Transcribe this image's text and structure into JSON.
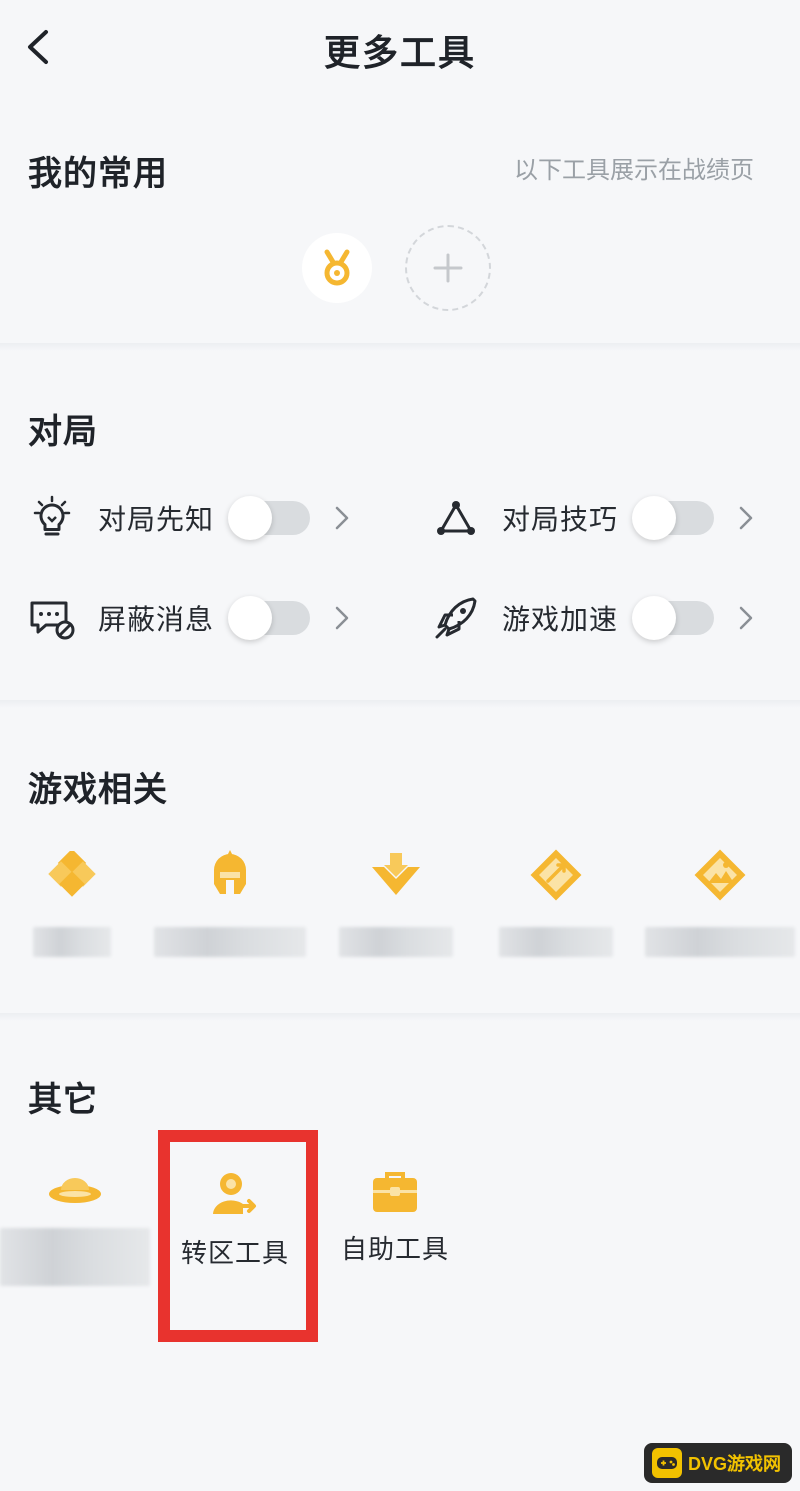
{
  "header": {
    "title": "更多工具",
    "back_icon": "chevron-left-icon"
  },
  "favorites": {
    "title": "我的常用",
    "hint": "以下工具展示在战绩页",
    "items": [
      {
        "icon": "medal-icon"
      }
    ],
    "add_icon": "plus-icon"
  },
  "match": {
    "title": "对局",
    "tools": [
      {
        "label": "对局先知",
        "icon": "lightbulb-icon",
        "enabled": false
      },
      {
        "label": "对局技巧",
        "icon": "triangle-nodes-icon",
        "enabled": false
      },
      {
        "label": "屏蔽消息",
        "icon": "message-block-icon",
        "enabled": false
      },
      {
        "label": "游戏加速",
        "icon": "rocket-icon",
        "enabled": false
      }
    ]
  },
  "game_related": {
    "title": "游戏相关",
    "items": [
      {
        "icon": "diamond-grid-icon",
        "label": ""
      },
      {
        "icon": "helmet-icon",
        "label": ""
      },
      {
        "icon": "diamond-download-icon",
        "label": ""
      },
      {
        "icon": "diamond-sword-icon",
        "label": ""
      },
      {
        "icon": "diamond-mountain-icon",
        "label": ""
      }
    ]
  },
  "others": {
    "title": "其它",
    "items": [
      {
        "icon": "ufo-icon",
        "label": ""
      },
      {
        "icon": "user-transfer-icon",
        "label": "转区工具"
      },
      {
        "icon": "toolbox-icon",
        "label": "自助工具"
      }
    ]
  },
  "colors": {
    "accent": "#f5b731",
    "highlight": "#e8332e",
    "background": "#f6f7f9"
  },
  "watermark": {
    "text": "DVG游戏网"
  }
}
